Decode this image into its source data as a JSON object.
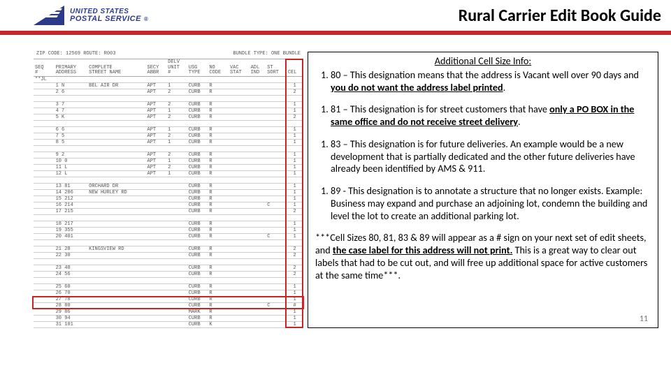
{
  "header": {
    "logo_line1": "UNITED STATES",
    "logo_line2": "POSTAL SERVICE",
    "reg": "®",
    "title": "Rural Carrier Edit Book Guide"
  },
  "sheet": {
    "top_left": "ZIP CODE:  12569   ROUTE:  R003",
    "top_right": "BUNDLE TYPE:  ONE BUNDLE",
    "cols": [
      "SEQ\n#",
      "PRIMARY\nADDRESS",
      "COMPLETE\nSTREET NAME",
      "SECY\nABBR",
      "DELV\nUNIT\n#",
      "USG\nTYPE",
      "NO\nCODE",
      "VAC\nSTAT",
      "ADL\nIND",
      "ST\nSORT",
      "CEL"
    ],
    "rows": [
      {
        "c": [
          "**JL",
          "",
          "",
          "",
          "",
          "",
          "",
          "",
          "",
          "",
          ""
        ]
      },
      {
        "c": [
          "",
          "1 N",
          "BEL AIR DR",
          "APT",
          "1",
          "CURB",
          "R",
          "",
          "",
          "",
          "1"
        ]
      },
      {
        "c": [
          "",
          "2 6",
          "",
          "APT",
          "2",
          "CURB",
          "R",
          "",
          "",
          "",
          "2"
        ]
      },
      {
        "c": [
          "",
          "",
          "",
          "",
          "",
          "",
          "",
          "",
          "",
          "",
          ""
        ]
      },
      {
        "c": [
          "",
          "3 7",
          "",
          "APT",
          "2",
          "CURB",
          "R",
          "",
          "",
          "",
          "1"
        ]
      },
      {
        "c": [
          "",
          "4 7",
          "",
          "APT",
          "1",
          "CURB",
          "R",
          "",
          "",
          "",
          "1"
        ]
      },
      {
        "c": [
          "",
          "5 K",
          "",
          "APT",
          "2",
          "CURB",
          "R",
          "",
          "",
          "",
          "2"
        ]
      },
      {
        "c": [
          "",
          "",
          "",
          "",
          "",
          "",
          "",
          "",
          "",
          "",
          ""
        ]
      },
      {
        "c": [
          "",
          "6 6",
          "",
          "APT",
          "1",
          "CURB",
          "R",
          "",
          "",
          "",
          "1"
        ]
      },
      {
        "c": [
          "",
          "7 5",
          "",
          "APT",
          "2",
          "CURB",
          "R",
          "",
          "",
          "",
          "1"
        ]
      },
      {
        "c": [
          "",
          "8 5",
          "",
          "APT",
          "1",
          "CURB",
          "R",
          "",
          "",
          "",
          "1"
        ]
      },
      {
        "c": [
          "",
          "",
          "",
          "",
          "",
          "",
          "",
          "",
          "",
          "",
          ""
        ]
      },
      {
        "c": [
          "",
          "9 2",
          "",
          "APT",
          "2",
          "CURB",
          "R",
          "",
          "",
          "",
          "1"
        ]
      },
      {
        "c": [
          "",
          "10 0",
          "",
          "APT",
          "1",
          "CURB",
          "R",
          "",
          "",
          "",
          "1"
        ]
      },
      {
        "c": [
          "",
          "11 L",
          "",
          "APT",
          "2",
          "CURB",
          "R",
          "",
          "",
          "",
          "1"
        ]
      },
      {
        "c": [
          "",
          "12 L",
          "",
          "APT",
          "1",
          "CURB",
          "R",
          "",
          "",
          "",
          "1"
        ]
      },
      {
        "c": [
          "",
          "",
          "",
          "",
          "",
          "",
          "",
          "",
          "",
          "",
          ""
        ]
      },
      {
        "c": [
          "",
          "13 81",
          "ORCHARD DR",
          "",
          "",
          "CURB",
          "R",
          "",
          "",
          "",
          "1"
        ]
      },
      {
        "c": [
          "",
          "14 206",
          "NEW HURLEY RD",
          "",
          "",
          "CURB",
          "R",
          "",
          "",
          "",
          "1"
        ]
      },
      {
        "c": [
          "",
          "15 212",
          "",
          "",
          "",
          "CURB",
          "R",
          "",
          "",
          "",
          "1"
        ]
      },
      {
        "c": [
          "",
          "16 214",
          "",
          "",
          "",
          "CURB",
          "R",
          "",
          "",
          "C",
          "1"
        ]
      },
      {
        "c": [
          "",
          "17 215",
          "",
          "",
          "",
          "CURB",
          "R",
          "",
          "",
          "",
          "2"
        ]
      },
      {
        "c": [
          "",
          "",
          "",
          "",
          "",
          "",
          "",
          "",
          "",
          "",
          ""
        ]
      },
      {
        "c": [
          "",
          "18 217",
          "",
          "",
          "",
          "CURB",
          "R",
          "",
          "",
          "",
          "1"
        ]
      },
      {
        "c": [
          "",
          "19 355",
          "",
          "",
          "",
          "CURB",
          "R",
          "",
          "",
          "",
          "1"
        ]
      },
      {
        "c": [
          "",
          "20 401",
          "",
          "",
          "",
          "CURB",
          "R",
          "",
          "",
          "C",
          "1"
        ]
      },
      {
        "c": [
          "",
          "",
          "",
          "",
          "",
          "",
          "",
          "",
          "",
          "",
          ""
        ]
      },
      {
        "c": [
          "",
          "21 28",
          "KINGSVIEW RD",
          "",
          "",
          "CURB",
          "R",
          "",
          "",
          "",
          "2"
        ]
      },
      {
        "c": [
          "",
          "22 30",
          "",
          "",
          "",
          "CURB",
          "R",
          "",
          "",
          "",
          "2"
        ]
      },
      {
        "c": [
          "",
          "",
          "",
          "",
          "",
          "",
          "",
          "",
          "",
          "",
          ""
        ]
      },
      {
        "c": [
          "",
          "23 40",
          "",
          "",
          "",
          "CURB",
          "R",
          "",
          "",
          "",
          "2"
        ]
      },
      {
        "c": [
          "",
          "24 56",
          "",
          "",
          "",
          "CURB",
          "R",
          "",
          "",
          "",
          "2"
        ]
      },
      {
        "c": [
          "",
          "",
          "",
          "",
          "",
          "",
          "",
          "",
          "",
          "",
          ""
        ]
      },
      {
        "c": [
          "",
          "25 60",
          "",
          "",
          "",
          "CURB",
          "R",
          "",
          "",
          "",
          "1"
        ]
      },
      {
        "c": [
          "",
          "26 70",
          "",
          "",
          "",
          "CURB",
          "R",
          "",
          "",
          "",
          "1"
        ]
      },
      {
        "c": [
          "",
          "27 78",
          "",
          "",
          "",
          "CURB",
          "R",
          "",
          "",
          "",
          "1"
        ],
        "hl": true
      },
      {
        "c": [
          "",
          "28 80",
          "",
          "",
          "",
          "CURB",
          "R",
          "",
          "",
          "C",
          "#"
        ],
        "hl": true
      },
      {
        "c": [
          "",
          "29 86",
          "",
          "",
          "",
          "MARK",
          "R",
          "",
          "",
          "",
          "1"
        ]
      },
      {
        "c": [
          "",
          "30 94",
          "",
          "",
          "",
          "CURB",
          "R",
          "",
          "",
          "",
          "1"
        ]
      },
      {
        "c": [
          "",
          "31 101",
          "",
          "",
          "",
          "CURB",
          "K",
          "",
          "",
          "",
          "1"
        ]
      }
    ]
  },
  "info": {
    "title": "Additional Cell Size Info",
    "colon": ":",
    "item80_a": "80 – This designation means that the address is Vacant well over 90 days and ",
    "item80_b": "you do not want the address label printed",
    "item80_c": ".",
    "item81_a": "81 – This designation is for street customers that have ",
    "item81_b": "only a PO BOX in the same office and do not receive street delivery",
    "item81_c": ".",
    "item83": "83 – This designation is for future deliveries.  An example would be a new development that is partially dedicated and the other future deliveries have already been identified by AMS & 911.",
    "item89": "89 - This designation is to annotate a structure that no longer exists.  Example:  Business may expand and purchase an adjoining lot, condemn the building and level the lot to create an additional parking lot.",
    "note_a": "***Cell Sizes 80, 81, 83 & 89 will appear as a # sign on your next set of edit sheets, and ",
    "note_b": "the case label for this address will not print.",
    "note_c": " This is a great way to clear out labels that had to be cut out, and will free up additional space for active customers at the same time***."
  },
  "page_number": "11"
}
